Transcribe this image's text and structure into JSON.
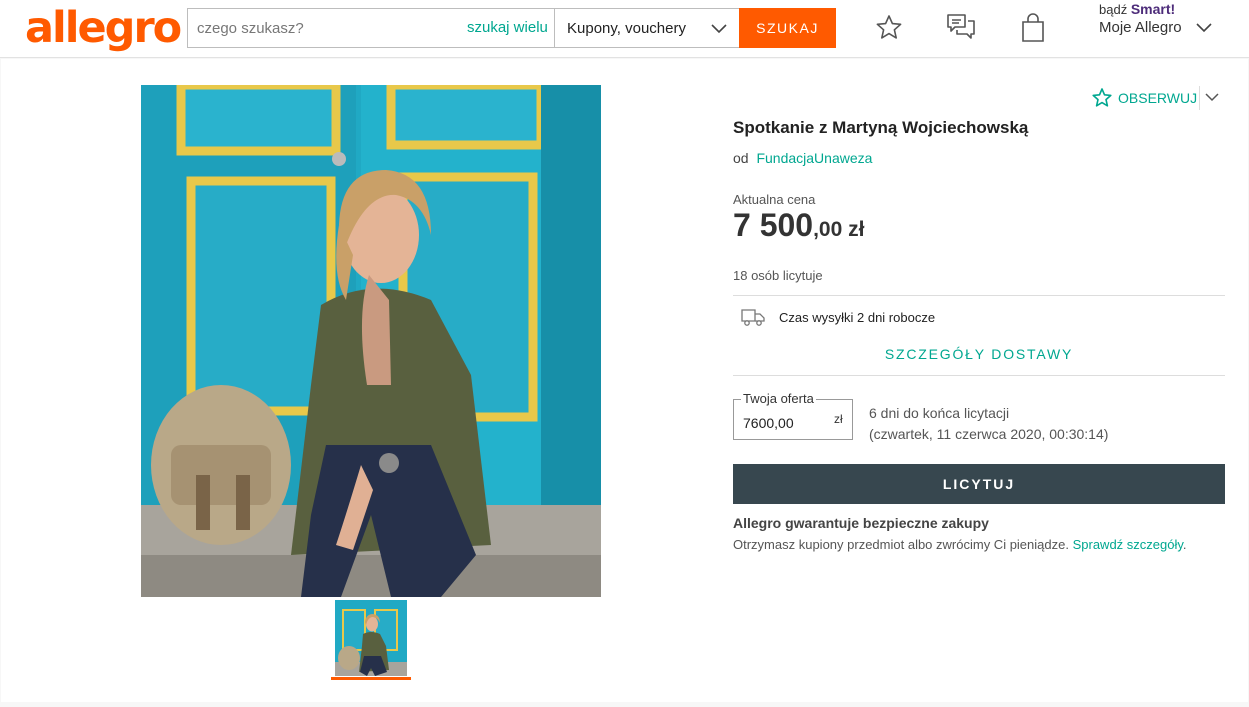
{
  "header": {
    "logo": "allegro",
    "search_placeholder": "czego szukasz?",
    "search_many": "szukaj wielu",
    "category": "Kupony, vouchery",
    "search_button": "SZUKAJ",
    "smart_prefix": "bądź",
    "smart_brand": "Smart!",
    "account_label": "Moje Allegro"
  },
  "listing": {
    "watch_label": "OBSERWUJ",
    "title": "Spotkanie z Martyną Wojciechowską",
    "seller_prefix": "od",
    "seller_name": "FundacjaUnaweza",
    "price_label": "Aktualna cena",
    "price_main": "7 500",
    "price_rest": ",00 zł",
    "bidders": "18 osób licytuje",
    "shipping": "Czas wysyłki 2 dni robocze",
    "delivery_details": "SZCZEGÓŁY DOSTAWY",
    "offer_label": "Twoja oferta",
    "offer_value": "7600,00",
    "offer_currency": "zł",
    "time_left": "6 dni do końca licytacji",
    "end_date": "(czwartek, 11 czerwca 2020, 00:30:14)",
    "bid_button": "LICYTUJ",
    "guarantee_title": "Allegro gwarantuje bezpieczne zakupy",
    "guarantee_text": "Otrzymasz kupiony przedmiot albo zwrócimy Ci pieniądze.",
    "guarantee_link": "Sprawdź szczegóły",
    "guarantee_end": "."
  },
  "colors": {
    "brand": "#ff5a00",
    "link": "#00a790",
    "bid_button": "#37474f"
  },
  "icons": {
    "watch": "star-icon",
    "messages": "chat-icon",
    "cart": "shopping-bag-icon",
    "shipping": "truck-icon"
  }
}
